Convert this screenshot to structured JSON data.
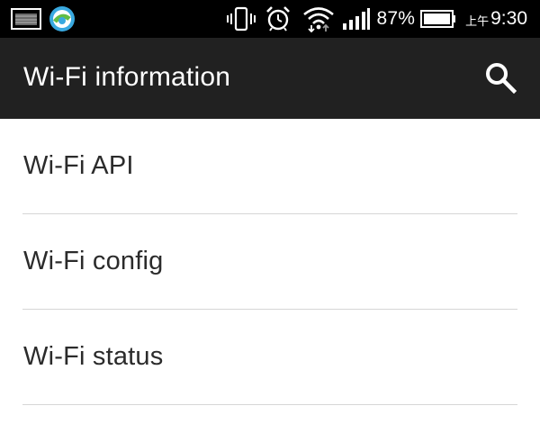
{
  "status_bar": {
    "battery_percent": "87%",
    "clock_prefix": "上午",
    "time": "9:30",
    "icons": [
      "notification-image-icon",
      "app-circle-icon",
      "vibrate-icon",
      "alarm-clock-icon",
      "wifi-data-icon",
      "cell-signal-icon",
      "battery-icon"
    ]
  },
  "app_bar": {
    "title": "Wi-Fi information",
    "search_icon": "search-icon"
  },
  "list": {
    "items": [
      {
        "label": "Wi-Fi API"
      },
      {
        "label": "Wi-Fi config"
      },
      {
        "label": "Wi-Fi status"
      }
    ]
  }
}
